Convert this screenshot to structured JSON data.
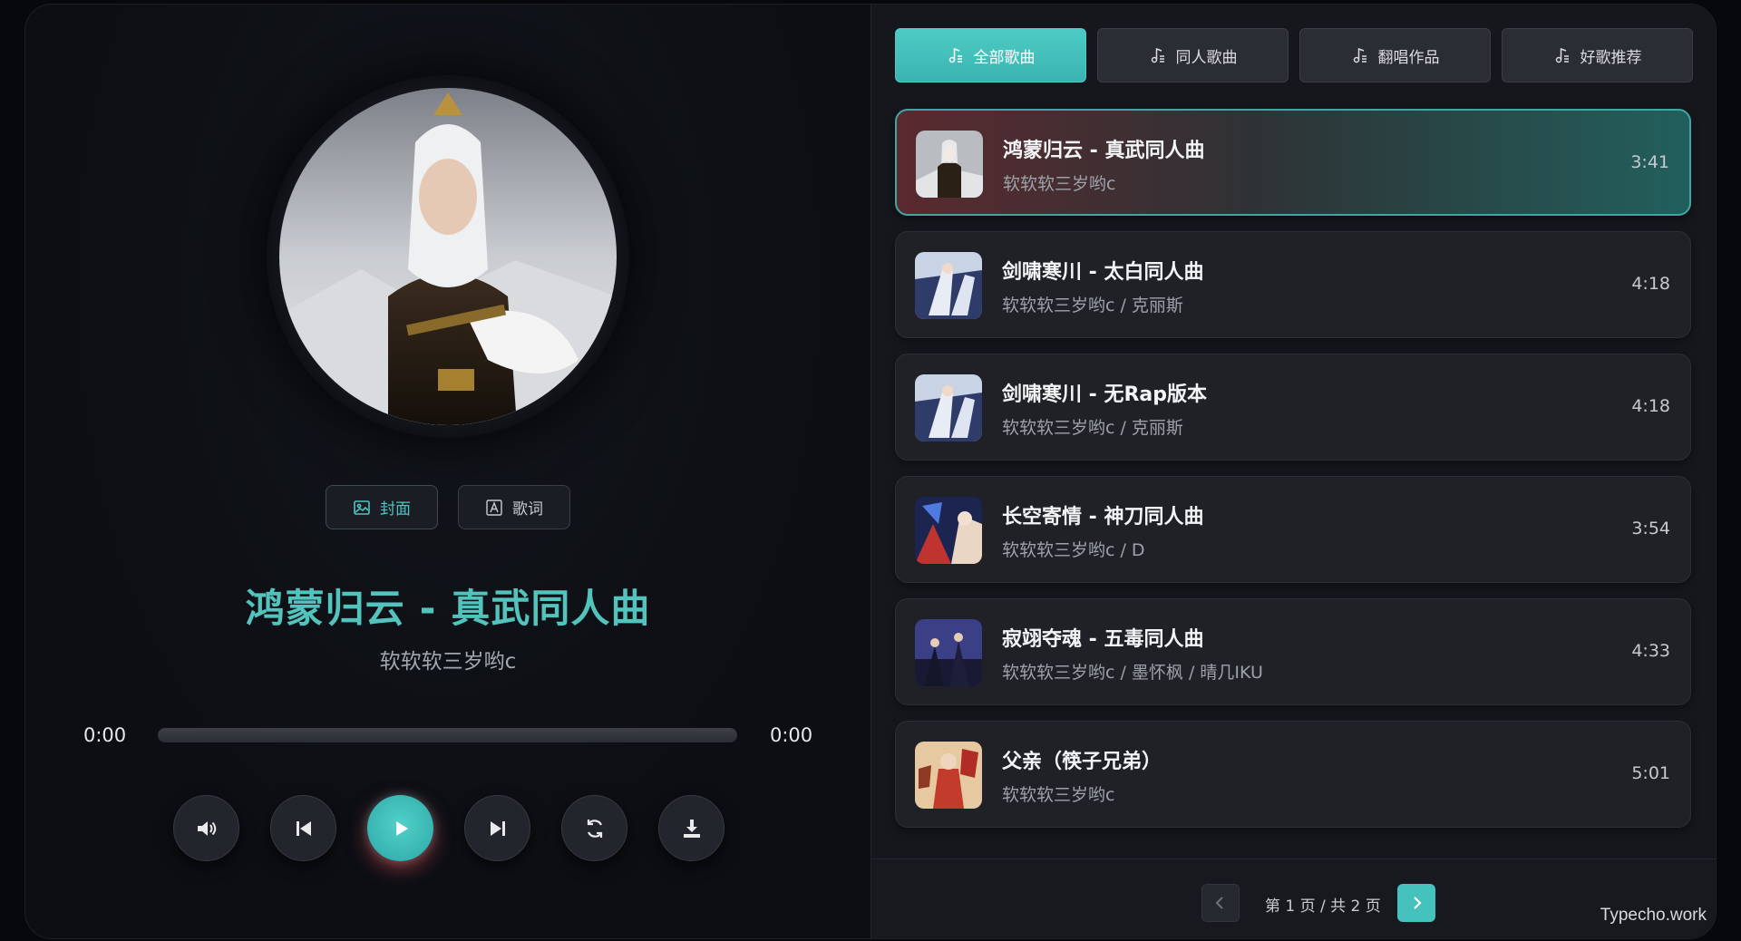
{
  "player": {
    "view_buttons": [
      {
        "label": "封面",
        "icon": "image-icon",
        "active": true
      },
      {
        "label": "歌词",
        "icon": "lyrics-icon",
        "active": false
      }
    ],
    "title": "鸿蒙归云 - 真武同人曲",
    "artist": "软软软三岁哟c",
    "current_time": "0:00",
    "total_time": "0:00",
    "progress": 0,
    "controls": [
      "volume-icon",
      "previous-icon",
      "play-icon",
      "next-icon",
      "repeat-icon",
      "download-icon"
    ]
  },
  "tabs": [
    {
      "label": "全部歌曲",
      "icon": "music-note-icon",
      "active": true
    },
    {
      "label": "同人歌曲",
      "icon": "music-note-icon",
      "active": false
    },
    {
      "label": "翻唱作品",
      "icon": "music-note-icon",
      "active": false
    },
    {
      "label": "好歌推荐",
      "icon": "music-note-icon",
      "active": false
    }
  ],
  "songs": [
    {
      "title": "鸿蒙归云 - 真武同人曲",
      "artist": "软软软三岁哟c",
      "duration": "3:41",
      "active": true
    },
    {
      "title": "剑啸寒川 - 太白同人曲",
      "artist": "软软软三岁哟c / 克丽斯",
      "duration": "4:18",
      "active": false
    },
    {
      "title": "剑啸寒川 - 无Rap版本",
      "artist": "软软软三岁哟c / 克丽斯",
      "duration": "4:18",
      "active": false
    },
    {
      "title": "长空寄情 - 神刀同人曲",
      "artist": "软软软三岁哟c / D",
      "duration": "3:54",
      "active": false
    },
    {
      "title": "寂翊夺魂 - 五毒同人曲",
      "artist": "软软软三岁哟c / 墨怀枫 / 晴几IKU",
      "duration": "4:33",
      "active": false
    },
    {
      "title": "父亲（筷子兄弟）",
      "artist": "软软软三岁哟c",
      "duration": "5:01",
      "active": false
    }
  ],
  "pagination": {
    "text": "第 1 页 / 共 2 页"
  },
  "watermark": "Typecho.work",
  "colors": {
    "accent": "#4fc4c0",
    "background": "#0c0e13",
    "panel": "#15171c"
  }
}
